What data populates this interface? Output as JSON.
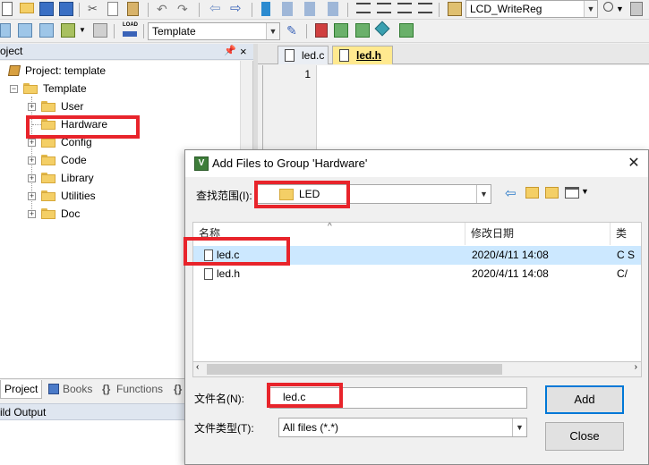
{
  "toolbar": {
    "function_combo_value": "LCD_WriteReg",
    "target_combo_value": "Template"
  },
  "project_panel": {
    "title": "oject",
    "pin_glyph": "q",
    "close_glyph": "×",
    "tree": {
      "project_label": "Project: template",
      "target_label": "Template",
      "groups": [
        "User",
        "Hardware",
        "Config",
        "Code",
        "Library",
        "Utilities",
        "Doc"
      ]
    },
    "bottom_tabs": {
      "project": "Project",
      "books": "Books",
      "functions": "Functions",
      "templates": "{}"
    }
  },
  "output": {
    "title": "ild Output"
  },
  "editor": {
    "tabs": [
      {
        "label": "led.c",
        "active": false
      },
      {
        "label": "led.h",
        "active": true
      }
    ],
    "line_numbers": [
      "1"
    ]
  },
  "dialog": {
    "title": "Add Files to Group 'Hardware'",
    "close_glyph": "✕",
    "look_in_label": "查找范围(I):",
    "look_in_value": "LED",
    "columns": {
      "name": "名称",
      "modified": "修改日期",
      "type": "类"
    },
    "files": [
      {
        "name": "led.c",
        "modified": "2020/4/11 14:08",
        "type": "C S",
        "selected": true
      },
      {
        "name": "led.h",
        "modified": "2020/4/11 14:08",
        "type": "C/",
        "selected": false
      }
    ],
    "filename_label": "文件名(N):",
    "filename_value": "led.c",
    "filetype_label": "文件类型(T):",
    "filetype_value": "All files (*.*)",
    "add_button": "Add",
    "close_button": "Close"
  },
  "colors": {
    "highlight_box": "#e8242b",
    "selection": "#cce8ff",
    "active_editor_tab": "#ffe98f"
  }
}
